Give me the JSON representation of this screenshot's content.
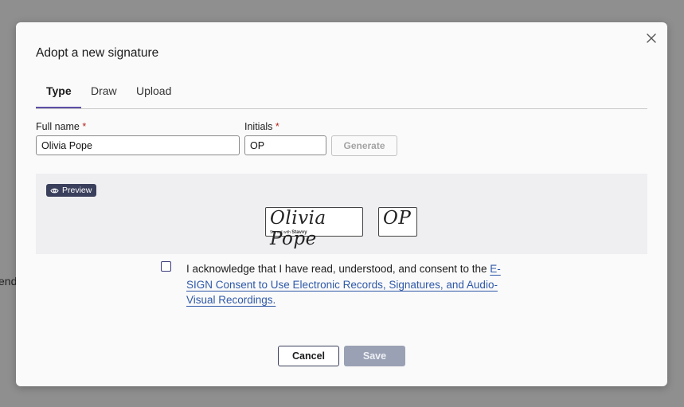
{
  "background": {
    "text": "end"
  },
  "dialog": {
    "title": "Adopt a new signature",
    "close_icon": "close-icon"
  },
  "tabs": [
    {
      "label": "Type",
      "active": true
    },
    {
      "label": "Draw",
      "active": false
    },
    {
      "label": "Upload",
      "active": false
    }
  ],
  "form": {
    "full_name_label": "Full name",
    "full_name_value": "Olivia Pope",
    "initials_label": "Initials",
    "initials_value": "OP",
    "required_mark": "*",
    "generate_label": "Generate"
  },
  "preview": {
    "badge_label": "Preview",
    "badge_icon": "eye-icon",
    "signature_text": "Olivia Pope",
    "signed_with_prefix": "Signed with",
    "signed_with_brand": "Stavvy",
    "initials_text": "OP"
  },
  "consent": {
    "text": "I acknowledge that I have read, understood, and consent to the ",
    "link_text": "E-SIGN Consent to Use Electronic Records, Signatures, and Audio-Visual Recordings."
  },
  "actions": {
    "cancel_label": "Cancel",
    "save_label": "Save"
  },
  "colors": {
    "accent": "#5b4fa5",
    "link": "#2f59a8",
    "badge_bg": "#3a3f5c",
    "save_disabled": "#9aa1b4",
    "required": "#b3261e"
  }
}
